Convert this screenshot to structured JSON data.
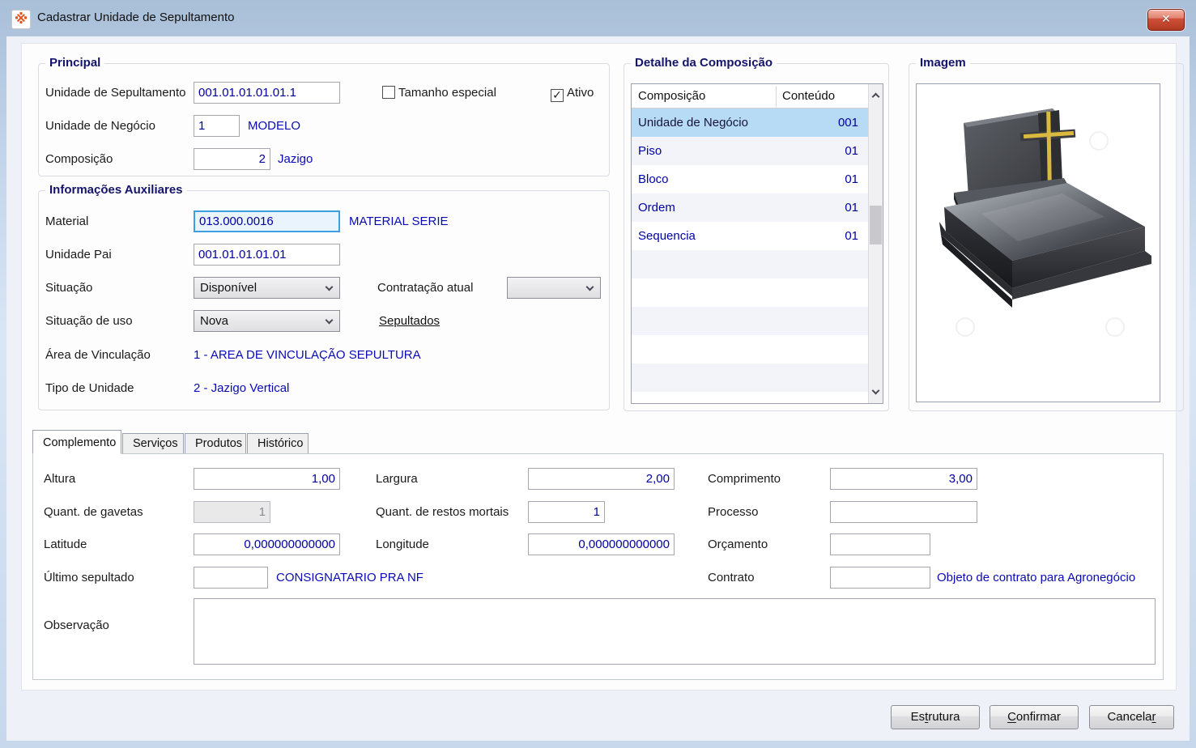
{
  "window": {
    "title": "Cadastrar Unidade de Sepultamento",
    "app_icon_glyph": "※",
    "close_glyph": "✕"
  },
  "colors": {
    "titlebar_blue": "#c9daee",
    "window_border_blue": "#b9cde8",
    "value_navy": "#00009c",
    "description_blue": "#0a0ab4",
    "group_title_navy": "#14146a",
    "selected_row_blue": "#b8dbf5",
    "close_button_red": "#c14431",
    "focus_border_blue": "#3e9fe0"
  },
  "principal": {
    "title": "Principal",
    "unidade_sepultamento": {
      "label": "Unidade de Sepultamento",
      "value": "001.01.01.01.01.1"
    },
    "tamanho_especial": {
      "label": "Tamanho especial",
      "checked": false,
      "checkmark": ""
    },
    "ativo": {
      "label": "Ativo",
      "checked": true,
      "checkmark": "✓"
    },
    "unidade_negocio": {
      "label": "Unidade de Negócio",
      "value": "1",
      "description": "MODELO"
    },
    "composicao": {
      "label": "Composição",
      "value": "2",
      "description": "Jazigo"
    }
  },
  "informacoes_auxiliares": {
    "title": "Informações Auxiliares",
    "material": {
      "label": "Material",
      "value": "013.000.0016",
      "description": "MATERIAL SERIE"
    },
    "unidade_pai": {
      "label": "Unidade Pai",
      "value": "001.01.01.01.01"
    },
    "situacao": {
      "label": "Situação",
      "value": "Disponível"
    },
    "contratacao_atual": {
      "label": "Contratação atual",
      "value": ""
    },
    "situacao_uso": {
      "label": "Situação de uso",
      "value": "Nova"
    },
    "sepultados_link": "Sepultados",
    "area_vinculacao": {
      "label": "Área de Vinculação",
      "value": "1 - AREA DE VINCULAÇÃO SEPULTURA"
    },
    "tipo_unidade": {
      "label": "Tipo de Unidade",
      "value": "2 - Jazigo Vertical"
    }
  },
  "detalhe_composicao": {
    "title": "Detalhe da Composição",
    "columns": {
      "composicao": "Composição",
      "conteudo": "Conteúdo"
    },
    "rows": [
      {
        "name": "Unidade de Negócio",
        "value": "001",
        "selected": true
      },
      {
        "name": "Piso",
        "value": "01",
        "selected": false
      },
      {
        "name": "Bloco",
        "value": "01",
        "selected": false
      },
      {
        "name": "Ordem",
        "value": "01",
        "selected": false
      },
      {
        "name": "Sequencia",
        "value": "01",
        "selected": false
      }
    ]
  },
  "imagem": {
    "title": "Imagem",
    "description": "tomb-with-cross-photo"
  },
  "tabs": {
    "complemento": "Complemento",
    "servicos": "Serviços",
    "produtos": "Produtos",
    "historico": "Histórico",
    "active": "Complemento"
  },
  "complemento": {
    "altura": {
      "label": "Altura",
      "value": "1,00"
    },
    "largura": {
      "label": "Largura",
      "value": "2,00"
    },
    "comprimento": {
      "label": "Comprimento",
      "value": "3,00"
    },
    "quant_gavetas": {
      "label": "Quant. de gavetas",
      "value": "1",
      "disabled": true
    },
    "quant_restos_mortais": {
      "label": "Quant. de restos mortais",
      "value": "1"
    },
    "processo": {
      "label": "Processo",
      "value": ""
    },
    "latitude": {
      "label": "Latitude",
      "value": "0,000000000000"
    },
    "longitude": {
      "label": "Longitude",
      "value": "0,000000000000"
    },
    "orcamento": {
      "label": "Orçamento",
      "value": ""
    },
    "ultimo_sepultado": {
      "label": "Último sepultado",
      "value": "",
      "description": "CONSIGNATARIO PRA NF"
    },
    "contrato": {
      "label": "Contrato",
      "value": "",
      "description": "Objeto de contrato para Agronegócio"
    },
    "observacao": {
      "label": "Observação",
      "value": ""
    }
  },
  "footer": {
    "estrutura": {
      "label": "Estrutura",
      "mnemonic_index": 2
    },
    "confirmar": {
      "label": "Confirmar",
      "mnemonic_index": 0
    },
    "cancelar": {
      "label": "Cancelar",
      "mnemonic_index": 7
    }
  }
}
